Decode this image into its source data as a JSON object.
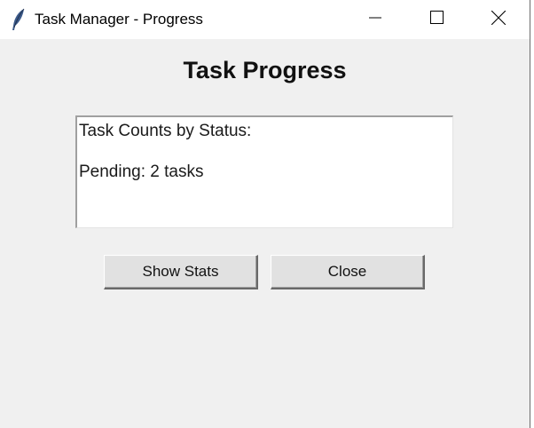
{
  "window": {
    "title": "Task Manager - Progress",
    "icon": "feather-icon"
  },
  "titlebar_buttons": {
    "minimize": "minimize-icon",
    "maximize": "maximize-icon",
    "close": "close-icon"
  },
  "heading": "Task Progress",
  "stats_box": {
    "lines": [
      "Task Counts by Status:",
      "",
      "Pending: 2 tasks"
    ]
  },
  "buttons": {
    "show_stats": "Show Stats",
    "close": "Close"
  }
}
